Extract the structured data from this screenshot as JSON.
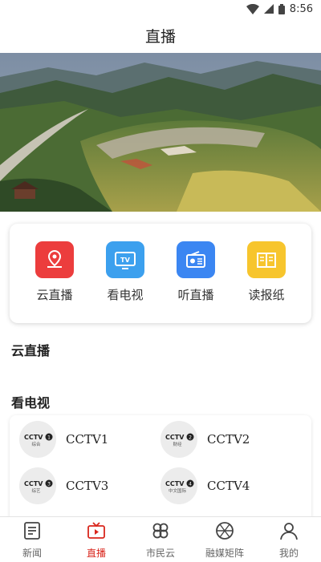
{
  "status_bar": {
    "time": "8:56"
  },
  "header": {
    "title": "直播"
  },
  "entries": [
    {
      "label": "云直播",
      "icon": "map-pin-icon",
      "color": "#ec3d3d"
    },
    {
      "label": "看电视",
      "icon": "tv-icon",
      "color": "#3ca0ee"
    },
    {
      "label": "听直播",
      "icon": "radio-icon",
      "color": "#3b86f2"
    },
    {
      "label": "读报纸",
      "icon": "newspaper-icon",
      "color": "#f7c52d"
    }
  ],
  "sections": {
    "cloud_live": "云直播",
    "watch_tv": "看电视"
  },
  "channels": [
    {
      "name": "CCTV1",
      "logo_text": "综合"
    },
    {
      "name": "CCTV2",
      "logo_text": "财经"
    },
    {
      "name": "CCTV3",
      "logo_text": "综艺"
    },
    {
      "name": "CCTV4",
      "logo_text": "中文国际"
    }
  ],
  "bottom_nav": [
    {
      "label": "新闻",
      "icon": "news-icon"
    },
    {
      "label": "直播",
      "icon": "live-tv-icon"
    },
    {
      "label": "市民云",
      "icon": "clover-icon"
    },
    {
      "label": "融媒矩阵",
      "icon": "media-matrix-icon"
    },
    {
      "label": "我的",
      "icon": "person-icon"
    }
  ],
  "colors": {
    "accent": "#d9261c"
  }
}
